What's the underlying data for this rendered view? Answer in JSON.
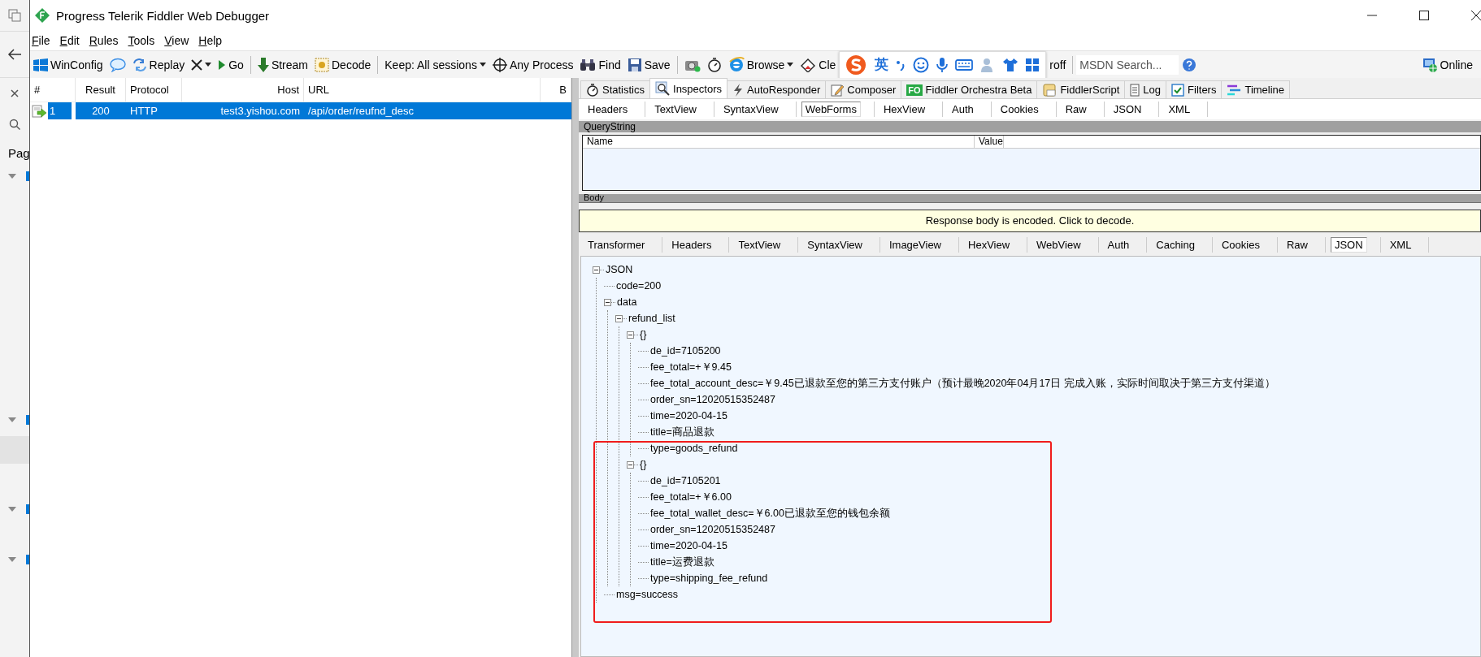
{
  "side_strip": {
    "label": "Pag"
  },
  "window": {
    "title": "Progress Telerik Fiddler Web Debugger"
  },
  "menu": [
    {
      "label": "File"
    },
    {
      "label": "Edit"
    },
    {
      "label": "Rules"
    },
    {
      "label": "Tools"
    },
    {
      "label": "View"
    },
    {
      "label": "Help"
    }
  ],
  "toolbar": [
    {
      "kind": "button",
      "label": "WinConfig"
    },
    {
      "kind": "icon"
    },
    {
      "kind": "button",
      "label": "Replay"
    },
    {
      "kind": "dropdown"
    },
    {
      "kind": "button",
      "label": "Go"
    },
    {
      "kind": "separator"
    },
    {
      "kind": "button",
      "label": "Stream"
    },
    {
      "kind": "button",
      "label": "Decode"
    },
    {
      "kind": "separator"
    },
    {
      "kind": "dropdown",
      "label": "Keep: All sessions"
    },
    {
      "kind": "button",
      "label": "Any Process"
    },
    {
      "kind": "button",
      "label": "Find"
    },
    {
      "kind": "button",
      "label": "Save"
    },
    {
      "kind": "separator"
    },
    {
      "kind": "icon"
    },
    {
      "kind": "icon"
    },
    {
      "kind": "dropdown",
      "label": "Browse"
    },
    {
      "kind": "button",
      "label": "Cle"
    },
    {
      "kind": "ime",
      "label": "英"
    },
    {
      "kind": "button",
      "label": "roff"
    },
    {
      "kind": "separator"
    },
    {
      "kind": "search",
      "placeholder": "MSDN Search..."
    },
    {
      "kind": "icon"
    }
  ],
  "online": {
    "label": "Online"
  },
  "sessions": {
    "columns": [
      "#",
      "Result",
      "Protocol",
      "Host",
      "URL",
      "B"
    ],
    "rows": [
      {
        "selected": true,
        "cells": [
          "1",
          "200",
          "HTTP",
          "test3.yishou.com",
          "/api/order/reufnd_desc",
          ""
        ]
      }
    ]
  },
  "inspector": {
    "tabs": [
      {
        "label": "Statistics",
        "selected": false
      },
      {
        "label": "Inspectors",
        "selected": true
      },
      {
        "label": "AutoResponder",
        "selected": false
      },
      {
        "label": "Composer",
        "selected": false
      },
      {
        "label": "Fiddler Orchestra Beta",
        "badge": "FO",
        "selected": false
      },
      {
        "label": "FiddlerScript",
        "selected": false
      },
      {
        "label": "Log",
        "selected": false
      },
      {
        "label": "Filters",
        "selected": false
      },
      {
        "label": "Timeline",
        "selected": false
      }
    ],
    "request_tabs": [
      {
        "label": "Headers",
        "selected": false
      },
      {
        "label": "TextView",
        "selected": false
      },
      {
        "label": "SyntaxView",
        "selected": false
      },
      {
        "label": "WebForms",
        "selected": true
      },
      {
        "label": "HexView",
        "selected": false
      },
      {
        "label": "Auth",
        "selected": false
      },
      {
        "label": "Cookies",
        "selected": false
      },
      {
        "label": "Raw",
        "selected": false
      },
      {
        "label": "JSON",
        "selected": false
      },
      {
        "label": "XML",
        "selected": false
      }
    ],
    "querystring": {
      "title": "QueryString",
      "columns": [
        "Name",
        "Value"
      ]
    },
    "body_title": "Body",
    "notice": "Response body is encoded. Click to decode.",
    "response_tabs": [
      {
        "label": "Transformer",
        "selected": false
      },
      {
        "label": "Headers",
        "selected": false
      },
      {
        "label": "TextView",
        "selected": false
      },
      {
        "label": "SyntaxView",
        "selected": false
      },
      {
        "label": "ImageView",
        "selected": false
      },
      {
        "label": "HexView",
        "selected": false
      },
      {
        "label": "WebView",
        "selected": false
      },
      {
        "label": "Auth",
        "selected": false
      },
      {
        "label": "Caching",
        "selected": false
      },
      {
        "label": "Cookies",
        "selected": false
      },
      {
        "label": "Raw",
        "selected": false
      },
      {
        "label": "JSON",
        "selected": true
      },
      {
        "label": "XML",
        "selected": false
      }
    ],
    "tree": {
      "label": "JSON",
      "expanded": true,
      "children": [
        {
          "label": "code=200"
        },
        {
          "label": "data",
          "expanded": true,
          "children": [
            {
              "label": "refund_list",
              "expanded": true,
              "children": [
                {
                  "label": "{}",
                  "expanded": true,
                  "children": [
                    {
                      "label": "de_id=7105200"
                    },
                    {
                      "label": "fee_total=+￥9.45"
                    },
                    {
                      "label": "fee_total_account_desc=￥9.45已退款至您的第三方支付账户（预计最晚2020年04月17日 完成入账，实际时间取决于第三方支付渠道）"
                    },
                    {
                      "label": "order_sn=12020515352487"
                    },
                    {
                      "label": "time=2020-04-15"
                    },
                    {
                      "label": "title=商品退款"
                    },
                    {
                      "label": "type=goods_refund"
                    }
                  ]
                },
                {
                  "label": "{}",
                  "expanded": true,
                  "children": [
                    {
                      "label": "de_id=7105201"
                    },
                    {
                      "label": "fee_total=+￥6.00"
                    },
                    {
                      "label": "fee_total_wallet_desc=￥6.00已退款至您的钱包余额"
                    },
                    {
                      "label": "order_sn=12020515352487"
                    },
                    {
                      "label": "time=2020-04-15"
                    },
                    {
                      "label": "title=运费退款"
                    },
                    {
                      "label": "type=shipping_fee_refund"
                    }
                  ]
                }
              ]
            }
          ]
        },
        {
          "label": "msg=success"
        }
      ]
    }
  }
}
